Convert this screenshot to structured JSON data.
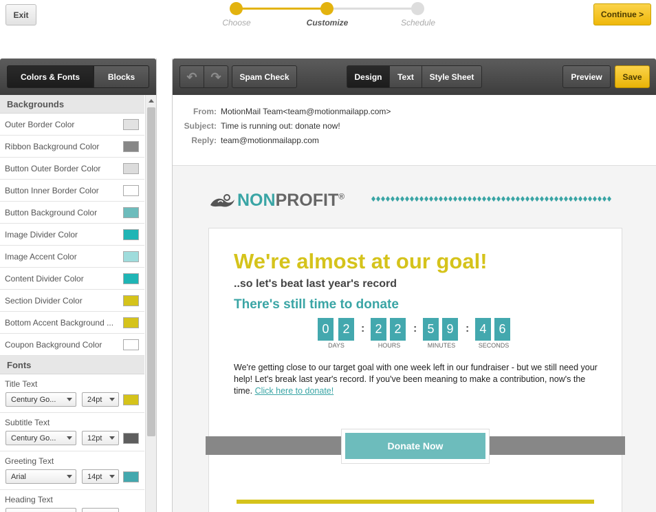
{
  "header": {
    "exit_label": "Exit",
    "continue_label": "Continue >",
    "steps": [
      {
        "label": "Choose",
        "state": "done"
      },
      {
        "label": "Customize",
        "state": "active"
      },
      {
        "label": "Schedule",
        "state": "pending"
      }
    ]
  },
  "left_panel": {
    "tabs": [
      "Colors & Fonts",
      "Blocks"
    ],
    "backgrounds_title": "Backgrounds",
    "colors": [
      {
        "label": "Outer Border Color",
        "color": "#e2e2e2"
      },
      {
        "label": "Ribbon Background Color",
        "color": "#878787"
      },
      {
        "label": "Button Outer Border Color",
        "color": "#dcdcdc"
      },
      {
        "label": "Button Inner Border Color",
        "color": "#ffffff"
      },
      {
        "label": "Button Background Color",
        "color": "#6dbcbc"
      },
      {
        "label": "Image Divider Color",
        "color": "#1fb5b5"
      },
      {
        "label": "Image Accent Color",
        "color": "#9fdcdc"
      },
      {
        "label": "Content Divider Color",
        "color": "#1fb5b5"
      },
      {
        "label": "Section Divider Color",
        "color": "#d5c31b"
      },
      {
        "label": "Bottom Accent Background ...",
        "color": "#d5c31b"
      },
      {
        "label": "Coupon Background Color",
        "color": "#ffffff"
      }
    ],
    "fonts_title": "Fonts",
    "fonts": [
      {
        "label": "Title Text",
        "family": "Century Go...",
        "size": "24pt",
        "color": "#d5c31b"
      },
      {
        "label": "Subtitle Text",
        "family": "Century Go...",
        "size": "12pt",
        "color": "#5e5e5e"
      },
      {
        "label": "Greeting Text",
        "family": "Arial",
        "size": "14pt",
        "color": "#43a8ae"
      },
      {
        "label": "Heading Text",
        "family": "",
        "size": "",
        "color": ""
      }
    ]
  },
  "toolbar": {
    "spam_check": "Spam Check",
    "views": [
      "Design",
      "Text",
      "Style Sheet"
    ],
    "preview": "Preview",
    "save": "Save"
  },
  "email_meta": {
    "from_label": "From:",
    "from_value": "MotionMail Team<team@motionmailapp.com>",
    "subject_label": "Subject:",
    "subject_value": "Time is running out: donate now!",
    "reply_label": "Reply:",
    "reply_value": "team@motionmailapp.com"
  },
  "email": {
    "logo_non": "NON",
    "logo_profit": "PROFIT",
    "logo_reg": "®",
    "headline": "We're almost at our goal!",
    "subhead": "..so let's beat last year's record",
    "still_time": "There's still time to donate",
    "countdown": {
      "digits": [
        "0",
        "2",
        "2",
        "2",
        "5",
        "9",
        "4",
        "6"
      ],
      "labels": [
        "DAYS",
        "HOURS",
        "MINUTES",
        "SECONDS"
      ]
    },
    "body": "We're getting close to our target goal with one week left in our fundraiser - but we still need your help! Let's break last year's record. If you've been meaning to make a contribution, now's the time.",
    "link": "Click here to donate!",
    "donate_button": "Donate Now"
  },
  "colors": {
    "accent_teal": "#3aa5a5",
    "accent_yellow": "#d5c31b",
    "save_yellow": "#efb80b"
  }
}
